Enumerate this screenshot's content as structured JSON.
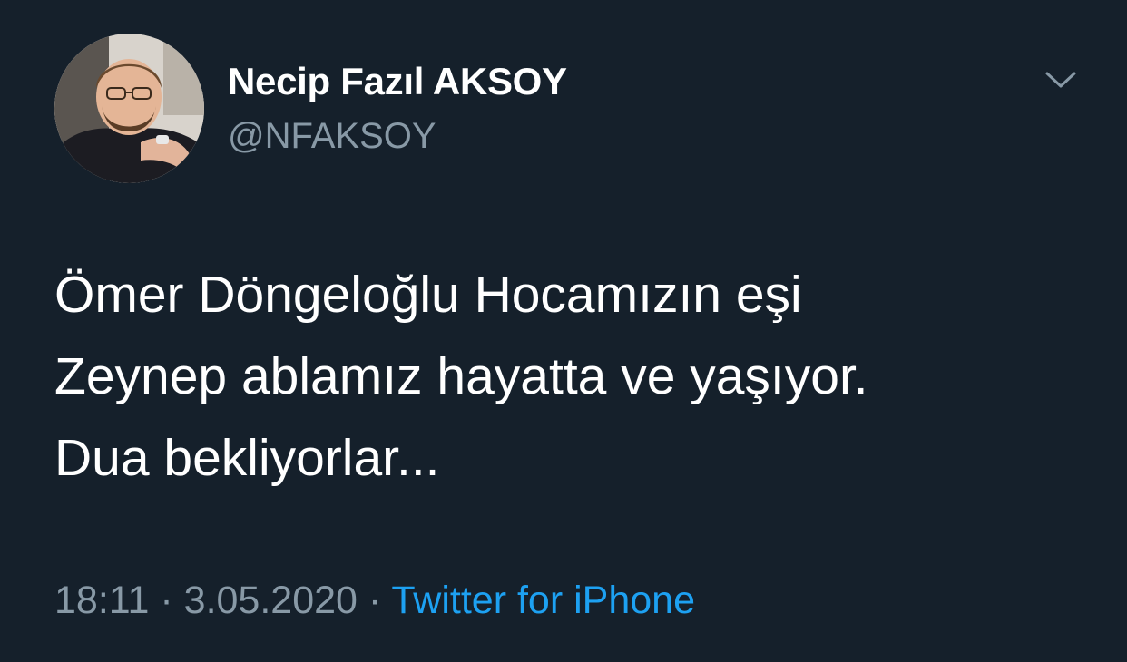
{
  "author": {
    "display_name": "Necip Fazıl AKSOY",
    "handle": "@NFAKSOY"
  },
  "tweet": {
    "lines": [
      "Ömer Döngeloğlu Hocamızın eşi",
      "Zeynep ablamız hayatta ve yaşıyor.",
      "Dua bekliyorlar..."
    ],
    "time": "18:11",
    "separator": "·",
    "date": "3.05.2020",
    "source": "Twitter for iPhone"
  },
  "icons": {
    "menu": "chevron-down-icon"
  },
  "colors": {
    "background": "#15202b",
    "primary_text": "#ffffff",
    "secondary_text": "#8899a6",
    "link": "#1da1f2"
  }
}
